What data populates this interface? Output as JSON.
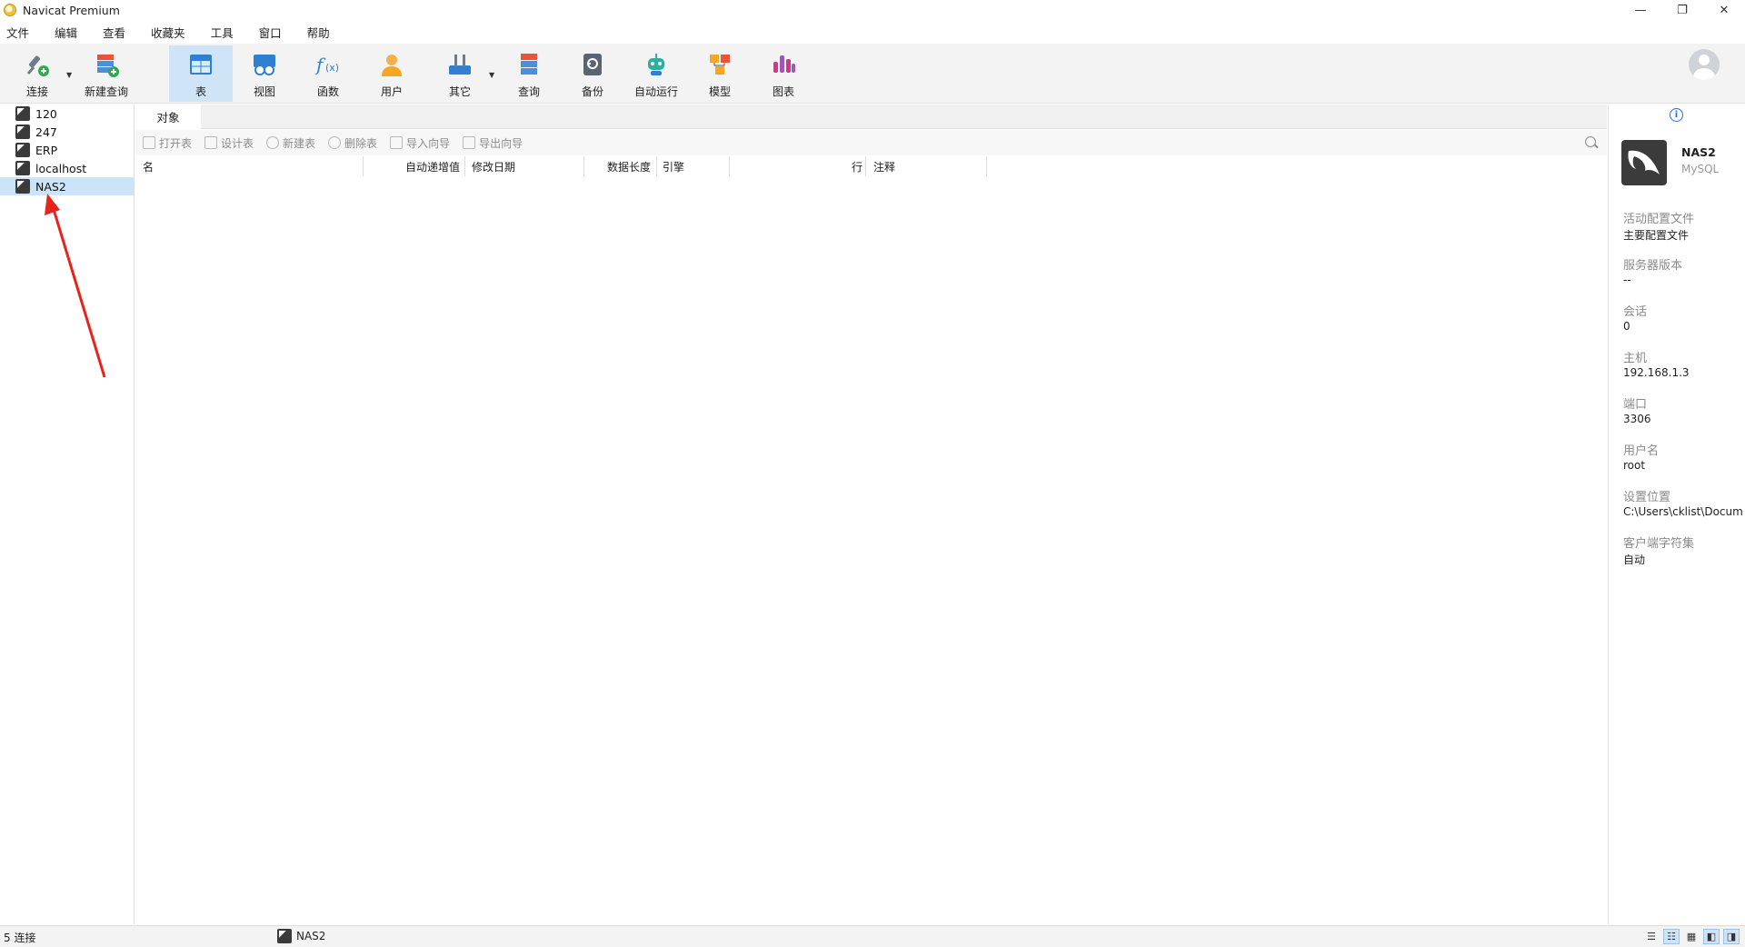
{
  "window": {
    "title": "Navicat Premium",
    "minimize": "—",
    "restore": "❐",
    "close": "✕"
  },
  "menu": [
    "文件",
    "编辑",
    "查看",
    "收藏夹",
    "工具",
    "窗口",
    "帮助"
  ],
  "toolbar": {
    "connect": "连接",
    "new_query": "新建查询",
    "table": "表",
    "view": "视图",
    "function": "函数",
    "user": "用户",
    "other": "其它",
    "query": "查询",
    "backup": "备份",
    "automation": "自动运行",
    "model": "模型",
    "chart": "图表"
  },
  "connections": [
    "120",
    "247",
    "ERP",
    "localhost",
    "NAS2"
  ],
  "selected_connection": "NAS2",
  "tabs": {
    "objects": "对象"
  },
  "object_toolbar": {
    "open_table": "打开表",
    "design_table": "设计表",
    "new_table": "新建表",
    "delete_table": "删除表",
    "import_wizard": "导入向导",
    "export_wizard": "导出向导"
  },
  "columns": {
    "name": "名",
    "auto_increment": "自动递增值",
    "modified": "修改日期",
    "data_length": "数据长度",
    "engine": "引擎",
    "rows": "行",
    "comment": "注释"
  },
  "info": {
    "name": "NAS2",
    "type": "MySQL",
    "props": [
      {
        "label": "活动配置文件",
        "value": "主要配置文件"
      },
      {
        "label": "服务器版本",
        "value": "--"
      },
      {
        "label": "会话",
        "value": "0"
      },
      {
        "label": "主机",
        "value": "192.168.1.3"
      },
      {
        "label": "端口",
        "value": "3306"
      },
      {
        "label": "用户名",
        "value": "root"
      },
      {
        "label": "设置位置",
        "value": "C:\\Users\\cklist\\Docum"
      },
      {
        "label": "客户端字符集",
        "value": "自动"
      }
    ]
  },
  "status": {
    "connections_count": "5 连接",
    "current_connection": "NAS2"
  },
  "colors": {
    "selection": "#cce4f7",
    "accent": "#1a73e8",
    "annotation_arrow": "#e8231a"
  }
}
